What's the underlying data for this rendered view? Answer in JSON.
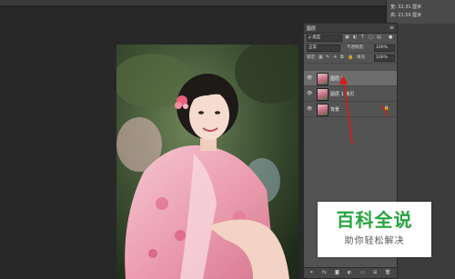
{
  "info": {
    "w_label": "宽:",
    "w_value": "32.31 厘米",
    "h_label": "高:",
    "h_value": "21.59 厘米"
  },
  "layers_panel": {
    "tab_label": "图层",
    "filter_label": "ρ 类型",
    "blend_mode": "正常",
    "opacity_label": "不透明度:",
    "opacity_value": "100%",
    "lock_label": "锁定:",
    "fill_label": "填充:",
    "fill_value": "100%",
    "layers": [
      {
        "name": "图层 1",
        "selected": true
      },
      {
        "name": "图层 1 拷贝",
        "selected": false
      },
      {
        "name": "背景",
        "selected": false,
        "locked": true
      }
    ]
  },
  "watermark": {
    "title": "百科全说",
    "subtitle": "助你轻松解决"
  },
  "colors": {
    "watermark_green": "#27a33f",
    "annotation_red": "#e01818"
  }
}
